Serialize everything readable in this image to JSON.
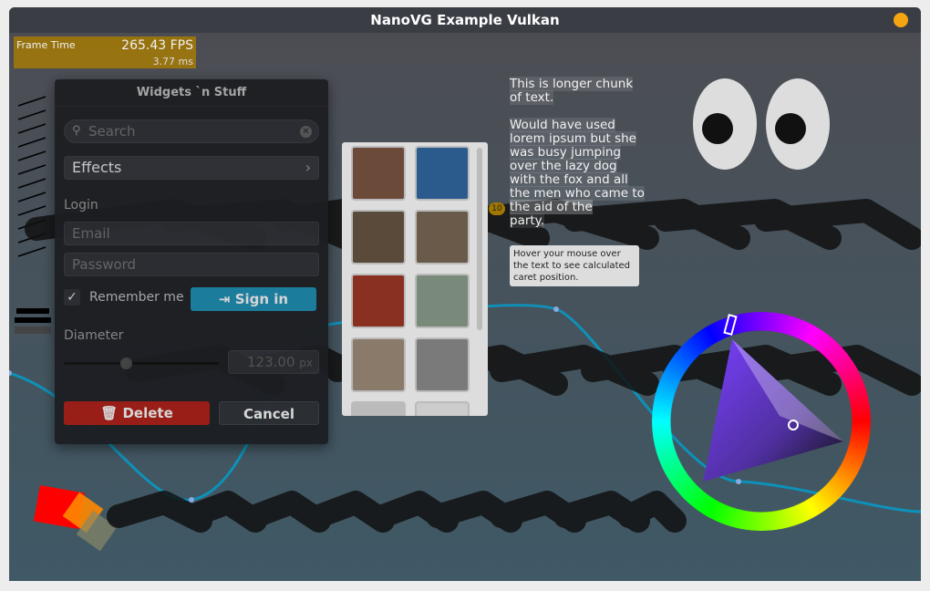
{
  "window": {
    "title": "NanoVG Example Vulkan"
  },
  "perf": {
    "label": "Frame Time",
    "fps": "265.43 FPS",
    "ms": "3.77 ms"
  },
  "panel": {
    "title": "Widgets `n Stuff",
    "search_placeholder": "Search",
    "dropdown_label": "Effects",
    "login_label": "Login",
    "email_placeholder": "Email",
    "password_placeholder": "Password",
    "remember_label": "Remember me",
    "remember_checked": true,
    "signin_label": "Sign in",
    "diameter_label": "Diameter",
    "diameter_value": "123.00",
    "diameter_unit": "px",
    "slider_fraction": 0.4,
    "delete_label": "Delete",
    "cancel_label": "Cancel"
  },
  "paragraph": {
    "lines1": [
      "This is longer chunk",
      "of text."
    ],
    "lines2": [
      "Would have used",
      "lorem ipsum but she",
      "was busy jumping",
      "over the lazy dog",
      "with the fox and all",
      "the men who came to",
      "the aid of the",
      "party."
    ],
    "badge": "10",
    "tooltip": "Hover your mouse over the text to see calculated caret position."
  },
  "colors": {
    "accent": "#1a7fa0",
    "delete": "#9e1c14",
    "perf": "#aa7d00",
    "curve": "#00a0d0"
  },
  "icons": [
    "search-icon",
    "clear-icon",
    "chevron-right-icon",
    "check-icon",
    "login-icon",
    "trash-icon"
  ]
}
